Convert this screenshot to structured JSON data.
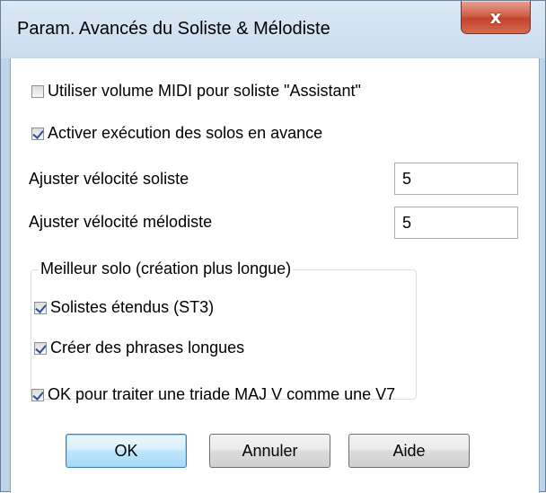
{
  "window": {
    "title": "Param. Avancés du Soliste & Mélodiste",
    "close_glyph": "x"
  },
  "options": {
    "midi_volume": {
      "label": "Utiliser volume MIDI pour soliste \"Assistant\"",
      "checked": false
    },
    "solo_ahead": {
      "label": "Activer exécution des solos en avance",
      "checked": true
    }
  },
  "velocity": {
    "soloist_label": "Ajuster vélocité soliste",
    "soloist_value": "5",
    "melodist_label": "Ajuster vélocité mélodiste",
    "melodist_value": "5"
  },
  "better_solo": {
    "title": "Meilleur solo (création plus longue)",
    "extended": {
      "label": "Solistes étendus (ST3)",
      "checked": true
    },
    "long_phrases": {
      "label": "Créer des phrases longues",
      "checked": true
    }
  },
  "triad_option": {
    "label": "OK pour traiter une triade MAJ V comme une V7",
    "checked": true
  },
  "buttons": {
    "ok": "OK",
    "cancel": "Annuler",
    "help": "Aide"
  }
}
